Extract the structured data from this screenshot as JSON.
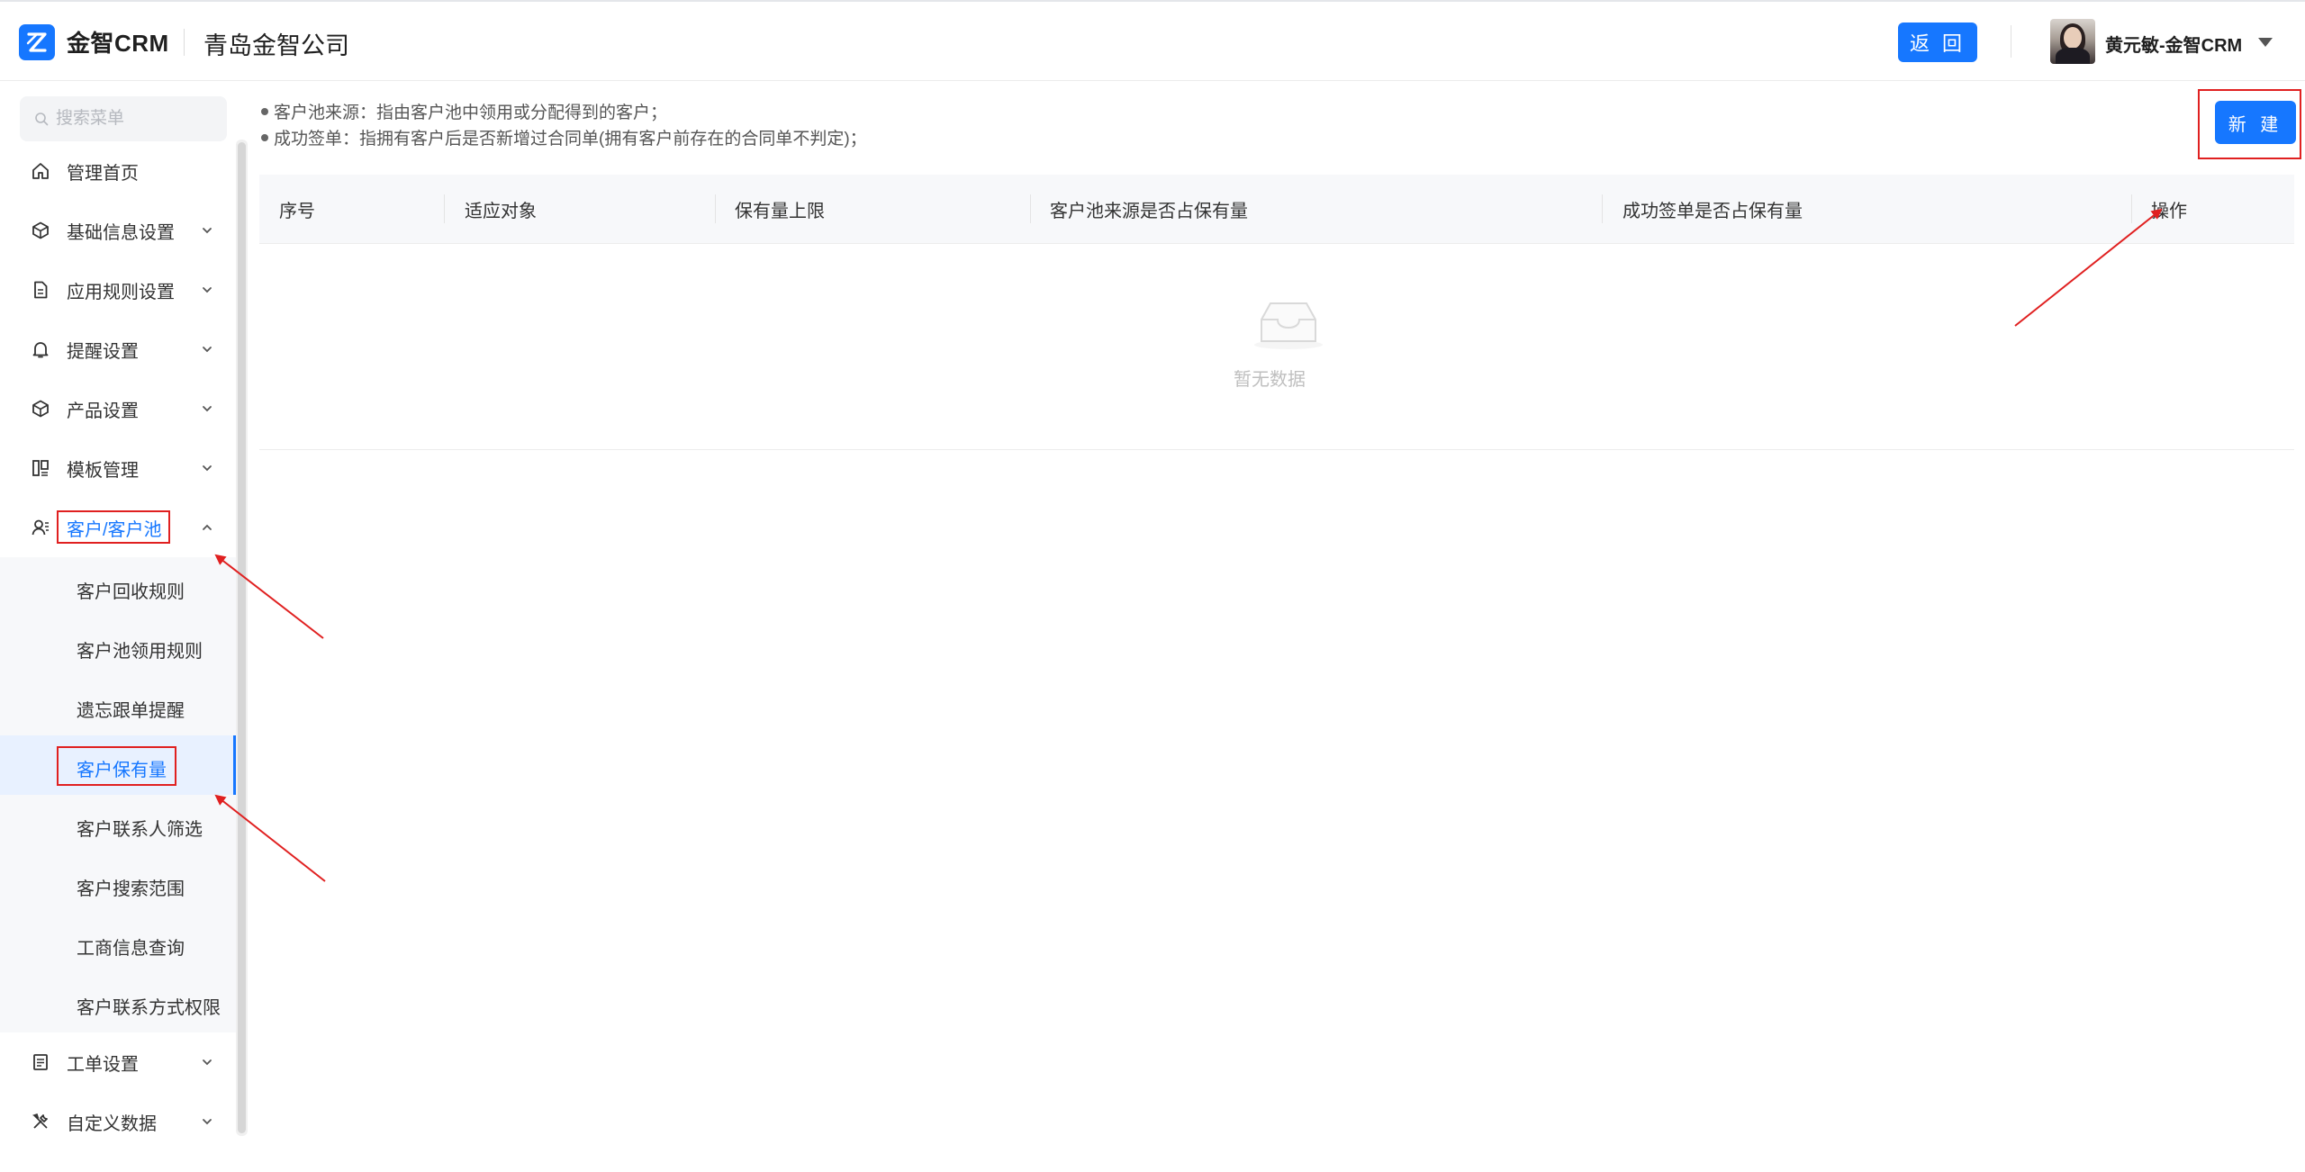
{
  "header": {
    "logo_text": "金智CRM",
    "company": "青岛金智公司",
    "back_label": "返 回",
    "user_name": "黄元敏-金智CRM"
  },
  "sidebar": {
    "search_placeholder": "搜索菜单",
    "items": [
      {
        "label": "管理首页",
        "icon": "home-icon",
        "expandable": false
      },
      {
        "label": "基础信息设置",
        "icon": "cube-icon",
        "expandable": true
      },
      {
        "label": "应用规则设置",
        "icon": "document-icon",
        "expandable": true
      },
      {
        "label": "提醒设置",
        "icon": "bell-icon",
        "expandable": true
      },
      {
        "label": "产品设置",
        "icon": "box-icon",
        "expandable": true
      },
      {
        "label": "模板管理",
        "icon": "template-icon",
        "expandable": true
      },
      {
        "label": "客户/客户池",
        "icon": "contacts-icon",
        "expandable": true,
        "expanded": true
      },
      {
        "label": "工单设置",
        "icon": "ticket-icon",
        "expandable": true
      },
      {
        "label": "自定义数据",
        "icon": "tools-icon",
        "expandable": true
      }
    ],
    "submenu": [
      {
        "label": "客户回收规则"
      },
      {
        "label": "客户池领用规则"
      },
      {
        "label": "遗忘跟单提醒"
      },
      {
        "label": "客户保有量",
        "active": true
      },
      {
        "label": "客户联系人筛选"
      },
      {
        "label": "客户搜索范围"
      },
      {
        "label": "工商信息查询"
      },
      {
        "label": "客户联系方式权限"
      }
    ]
  },
  "main": {
    "notes": [
      "客户池来源：指由客户池中领用或分配得到的客户；",
      "成功签单：指拥有客户后是否新增过合同单(拥有客户前存在的合同单不判定)；"
    ],
    "new_button_label": "新 建",
    "table": {
      "columns": [
        "序号",
        "适应对象",
        "保有量上限",
        "客户池来源是否占保有量",
        "成功签单是否占保有量",
        "操作"
      ],
      "rows": [],
      "empty_text": "暂无数据"
    }
  },
  "colors": {
    "primary": "#1677ff",
    "annotation_red": "#e02020",
    "submenu_bg": "#f7f8fa",
    "active_bg": "#e8f1ff"
  }
}
